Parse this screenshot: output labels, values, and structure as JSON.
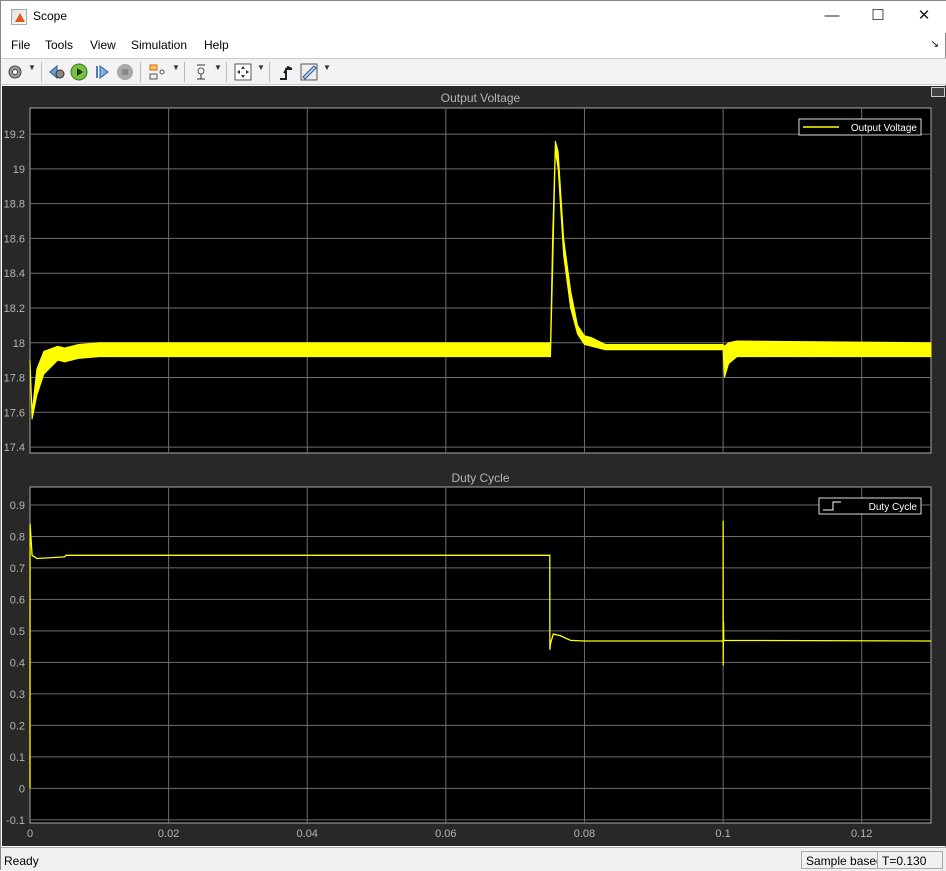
{
  "window": {
    "title": "Scope",
    "minimize": "—",
    "maximize": "☐",
    "close": "✕"
  },
  "menu": [
    "File",
    "Tools",
    "View",
    "Simulation",
    "Help"
  ],
  "toolbar": [
    "configuration-icon",
    "step-back-icon",
    "run-icon",
    "step-forward-icon",
    "stop-icon",
    "signal-selection-icon",
    "zoom-icon",
    "autoscale-icon",
    "triggers-icon",
    "measurements-icon"
  ],
  "status": {
    "text": "Ready",
    "mode": "Sample based",
    "time": "T=0.130"
  },
  "colors": {
    "trace": "#ffff00",
    "grid": "#6e6e6e",
    "axes_bg": "#000000",
    "figure_bg": "#282828",
    "text": "#b4b4b4"
  },
  "chart_data": [
    {
      "type": "line",
      "title": "Output Voltage",
      "legend": [
        "Output Voltage"
      ],
      "legend_placement": "top-right",
      "xlim": [
        0,
        0.13
      ],
      "ylim": [
        17.366,
        19.35
      ],
      "xticks": [
        "0",
        "0.02",
        "0.04",
        "0.06",
        "0.08",
        "0.1",
        "0.12"
      ],
      "xtick_values": [
        0,
        0.02,
        0.04,
        0.06,
        0.08,
        0.1,
        0.12
      ],
      "yticks": [
        "17.4",
        "17.6",
        "17.8",
        "18",
        "18.2",
        "18.4",
        "18.6",
        "18.8",
        "19",
        "19.2"
      ],
      "ytick_values": [
        17.4,
        17.6,
        17.8,
        18,
        18.2,
        18.4,
        18.6,
        18.8,
        19,
        19.2
      ],
      "series": [
        {
          "name": "Output Voltage",
          "envelope": true,
          "x": [
            0,
            0.0003,
            0.001,
            0.002,
            0.004,
            0.005,
            0.007,
            0.01,
            0.075,
            0.0751,
            0.0754,
            0.0758,
            0.0762,
            0.077,
            0.078,
            0.079,
            0.08,
            0.081,
            0.083,
            0.1,
            0.1002,
            0.1008,
            0.102,
            0.13
          ],
          "upper": [
            17.9,
            17.6,
            17.85,
            17.95,
            17.98,
            17.97,
            17.99,
            18.0,
            18.0,
            18.0,
            18.6,
            19.16,
            19.1,
            18.6,
            18.3,
            18.1,
            18.04,
            18.03,
            17.99,
            17.99,
            17.98,
            18.0,
            18.01,
            18.0
          ],
          "lower": [
            17.88,
            17.56,
            17.7,
            17.82,
            17.9,
            17.89,
            17.91,
            17.92,
            17.92,
            17.92,
            18.4,
            19.1,
            19.0,
            18.5,
            18.2,
            18.05,
            17.99,
            17.98,
            17.96,
            17.96,
            17.8,
            17.88,
            17.92,
            17.92
          ]
        }
      ]
    },
    {
      "type": "line",
      "title": "Duty Cycle",
      "legend": [
        "Duty Cycle"
      ],
      "legend_placement": "top-right",
      "xlim": [
        0,
        0.13
      ],
      "ylim": [
        -0.11,
        0.957
      ],
      "xticks": [
        "0",
        "0.02",
        "0.04",
        "0.06",
        "0.08",
        "0.1",
        "0.12"
      ],
      "xtick_values": [
        0,
        0.02,
        0.04,
        0.06,
        0.08,
        0.1,
        0.12
      ],
      "yticks": [
        "-0.1",
        "0",
        "0.1",
        "0.2",
        "0.3",
        "0.4",
        "0.5",
        "0.6",
        "0.7",
        "0.8",
        "0.9"
      ],
      "ytick_values": [
        -0.1,
        0,
        0.1,
        0.2,
        0.3,
        0.4,
        0.5,
        0.6,
        0.7,
        0.8,
        0.9
      ],
      "series": [
        {
          "name": "Duty Cycle",
          "x": [
            0,
            1e-05,
            0.0003,
            0.001,
            0.005,
            0.0052,
            0.075,
            0.07501,
            0.0751,
            0.0755,
            0.0765,
            0.078,
            0.08,
            0.1,
            0.10001,
            0.10002,
            0.10005,
            0.1001,
            0.13
          ],
          "y": [
            0,
            0.84,
            0.74,
            0.73,
            0.735,
            0.74,
            0.74,
            0.44,
            0.46,
            0.49,
            0.485,
            0.47,
            0.468,
            0.468,
            0.85,
            0.39,
            0.53,
            0.47,
            0.468
          ]
        }
      ]
    }
  ]
}
